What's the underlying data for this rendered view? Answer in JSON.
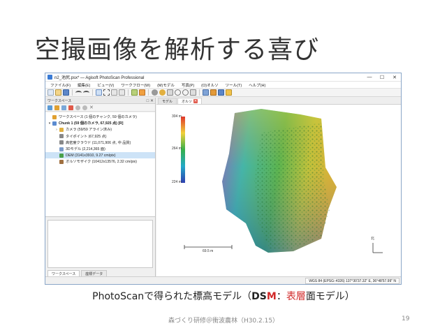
{
  "slide": {
    "title": "空撮画像を解析する喜び",
    "caption_prefix": "PhotoScanで得られた標高モデル（",
    "caption_dsm_d": "DS",
    "caption_dsm_m": "M",
    "caption_colon": "：",
    "caption_red": "表層",
    "caption_suffix": "面モデル）",
    "footer": "森づくり研修＠衝波農林（H30.2.15）",
    "page_number": "19"
  },
  "window": {
    "title": "n2_池尻.psx* — Agisoft PhotoScan Professional",
    "minimize": "—",
    "maximize": "☐",
    "close": "✕"
  },
  "menu": {
    "items": [
      "ファイル(F)",
      "編集(E)",
      "ビュー(V)",
      "ワークフロー(W)",
      "(M)モデル",
      "写真(P)",
      "(O)オルソ",
      "ツール(T)",
      "ヘルプ(H)"
    ]
  },
  "workspace": {
    "panel_title": "ワークスペース",
    "panel_controls": "□ ✕",
    "tree": [
      {
        "label": "ワークスペース (1 個のチャンク, 59 個のカメラ)",
        "bold": false,
        "indent": 0,
        "arrow": "",
        "color": "#e0a030"
      },
      {
        "label": "Chunk 1 (59 個のカメラ, 67,925 点) [R]",
        "bold": true,
        "indent": 0,
        "arrow": "▾",
        "color": "#5b8bd0"
      },
      {
        "label": "カメラ (59/59 アライン済み)",
        "bold": false,
        "indent": 1,
        "arrow": "›",
        "color": "#e0b040"
      },
      {
        "label": "タイポイント (67,925 点)",
        "bold": false,
        "indent": 1,
        "arrow": "",
        "color": "#888888"
      },
      {
        "label": "高密度クラウド (11,071,906 点, 中 品質)",
        "bold": false,
        "indent": 1,
        "arrow": "",
        "color": "#888888"
      },
      {
        "label": "3Dモデル (2,214,365 面)",
        "bold": false,
        "indent": 1,
        "arrow": "",
        "color": "#7a9ac8"
      },
      {
        "label": "DEM (3141x3910, 9.27 cm/pix)",
        "bold": false,
        "indent": 1,
        "arrow": "",
        "color": "#4aa04a",
        "selected": true
      },
      {
        "label": "オルソモザイク (10412x13576, 2.32 cm/pix)",
        "bold": false,
        "indent": 1,
        "arrow": "",
        "color": "#a07040"
      }
    ],
    "bottom_tabs": [
      "ワークスペース",
      "座標データ"
    ]
  },
  "view": {
    "tabs": [
      "モデル",
      "オルソ"
    ],
    "elevation_legend": [
      "304 m",
      "264 m",
      "224 m"
    ],
    "scale_bar": "69.5 m",
    "north_label": "北"
  },
  "status": {
    "coordinates": "WGS 84 (EPSG::4326)  137°30'37.32\" E,  36°48'57.99\" N"
  },
  "colors": {
    "accent": "#3a7bd5",
    "dsm_red": "#d12a2a",
    "selected_row": "#cde3f7"
  }
}
